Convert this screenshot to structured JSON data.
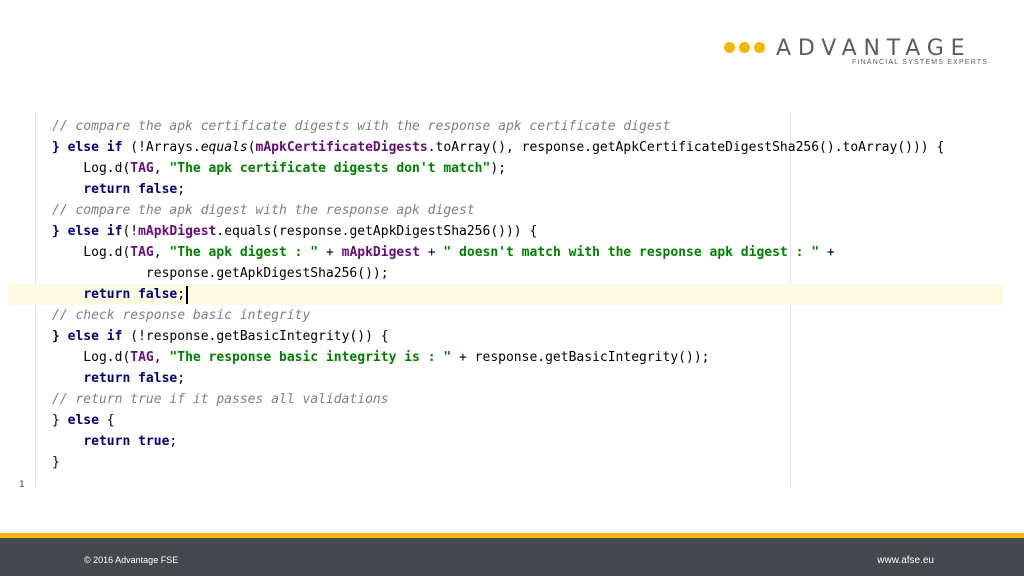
{
  "logo": {
    "wordmark": "ADVANTAGE",
    "tagline": "FINANCIAL SYSTEMS EXPERTS",
    "brand_color": "#f5b800",
    "text_color": "#5a5d63"
  },
  "code": {
    "line1": "// compare the apk certificate digests with the response apk certificate digest",
    "line2": {
      "brace_else_if": "} else if",
      "pre": " (!Arrays.",
      "equals": "equals",
      "paren": "(",
      "field": "mApkCertificateDigests",
      "post": ".toArray(), response.getApkCertificateDigestSha256().toArray())) {"
    },
    "line3": {
      "pre": "    Log.d(",
      "tag": "TAG",
      "comma": ", ",
      "str": "\"The apk certificate digests don't match\"",
      "post": ");"
    },
    "line4": {
      "indent": "    ",
      "kw": "return false",
      "post": ";"
    },
    "line5": "// compare the apk digest with the response apk digest",
    "line6": {
      "brace_else_if": "} else if",
      "pre": "(!",
      "field": "mApkDigest",
      "post": ".equals(response.getApkDigestSha256())) {"
    },
    "line7": {
      "pre": "    Log.d(",
      "tag": "TAG",
      "comma": ", ",
      "str1": "\"The apk digest : \"",
      "plus1": " + ",
      "field": "mApkDigest",
      "plus2": " + ",
      "str2": "\" doesn't match with the response apk digest : \"",
      "plus3": " +"
    },
    "line8": "            response.getApkDigestSha256());",
    "line9": {
      "indent": "    ",
      "kw": "return false",
      "post": ";"
    },
    "line10": "// check response basic integrity",
    "line11": {
      "brace_else_if": "} else if",
      "post": " (!response.getBasicIntegrity()) {"
    },
    "line12": {
      "pre": "    Log.d(",
      "tag": "TAG",
      "comma": ", ",
      "str": "\"The response basic integrity is : \"",
      "post": " + response.getBasicIntegrity());"
    },
    "line13": {
      "indent": "    ",
      "kw": "return false",
      "post": ";"
    },
    "line14": "// return true if it passes all validations",
    "line15": {
      "brace": "} ",
      "kw": "else",
      "post": " {"
    },
    "line16": {
      "indent": "    ",
      "kw": "return true",
      "post": ";"
    },
    "line17": "}",
    "line_number": "1"
  },
  "footer": {
    "copyright": "© 2016 Advantage FSE",
    "website": "www.afse.eu"
  }
}
